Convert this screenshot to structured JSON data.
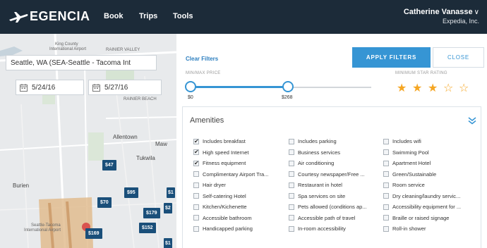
{
  "nav": {
    "logo_text": "EGENCIA",
    "links": [
      "Book",
      "Trips",
      "Tools"
    ],
    "user_name": "Catherine Vanasse",
    "user_chevron": "∨",
    "company": "Expedia, Inc."
  },
  "search": {
    "location": "Seattle, WA (SEA-Seattle - Tacoma Int",
    "checkin": "5/24/16",
    "checkout": "5/27/16"
  },
  "map": {
    "labels": [
      "King County",
      "International Airport",
      "RAINIER VALLEY",
      "RAINIER BEACH",
      "Allentown",
      "Tukwila",
      "Burien",
      "Seattle-Tacoma",
      "International Airport",
      "Maw"
    ],
    "prices": [
      "$47",
      "$95",
      "$70",
      "$179",
      "$152",
      "$169",
      "$1",
      "$2",
      "$1"
    ]
  },
  "filters": {
    "clear_label": "Clear Filters",
    "apply_label": "APPLY FILTERS",
    "close_label": "CLOSE",
    "price_label": "MIN/MAX PRICE",
    "star_label": "MINIMUM STAR RATING",
    "price_min": "$0",
    "price_max": "$268",
    "star_rating": 3,
    "star_max": 5,
    "star_color": "#f5a623",
    "accent_color": "#3695d4",
    "amenities_title": "Amenities",
    "amenities": [
      [
        {
          "label": "Includes breakfast",
          "checked": true
        },
        {
          "label": "High speed Internet",
          "checked": true
        },
        {
          "label": "Fitness equipment",
          "checked": true
        },
        {
          "label": "Complimentary Airport Tra...",
          "checked": false
        },
        {
          "label": "Hair dryer",
          "checked": false
        },
        {
          "label": "Self-catering Hotel",
          "checked": false
        },
        {
          "label": "Kitchen/Kichenette",
          "checked": false
        },
        {
          "label": "Accessible bathroom",
          "checked": false
        },
        {
          "label": "Handicapped parking",
          "checked": false
        }
      ],
      [
        {
          "label": "Includes parking",
          "checked": false
        },
        {
          "label": "Business services",
          "checked": false
        },
        {
          "label": "Air conditioning",
          "checked": false
        },
        {
          "label": "Courtesy newspaper/Free ...",
          "checked": false
        },
        {
          "label": "Restaurant in hotel",
          "checked": false
        },
        {
          "label": "Spa services on site",
          "checked": false
        },
        {
          "label": "Pets allowed (conditions ap...",
          "checked": false
        },
        {
          "label": "Accessible path of travel",
          "checked": false
        },
        {
          "label": "In-room accessibility",
          "checked": false
        }
      ],
      [
        {
          "label": "Includes wifi",
          "checked": false
        },
        {
          "label": "Swimming Pool",
          "checked": false
        },
        {
          "label": "Apartment Hotel",
          "checked": false
        },
        {
          "label": "Green/Sustainable",
          "checked": false
        },
        {
          "label": "Room service",
          "checked": false
        },
        {
          "label": "Dry cleaning/laundry servic...",
          "checked": false
        },
        {
          "label": "Accessibility equipment for ...",
          "checked": false
        },
        {
          "label": "Braille or raised signage",
          "checked": false
        },
        {
          "label": "Roll-in shower",
          "checked": false
        }
      ]
    ]
  }
}
